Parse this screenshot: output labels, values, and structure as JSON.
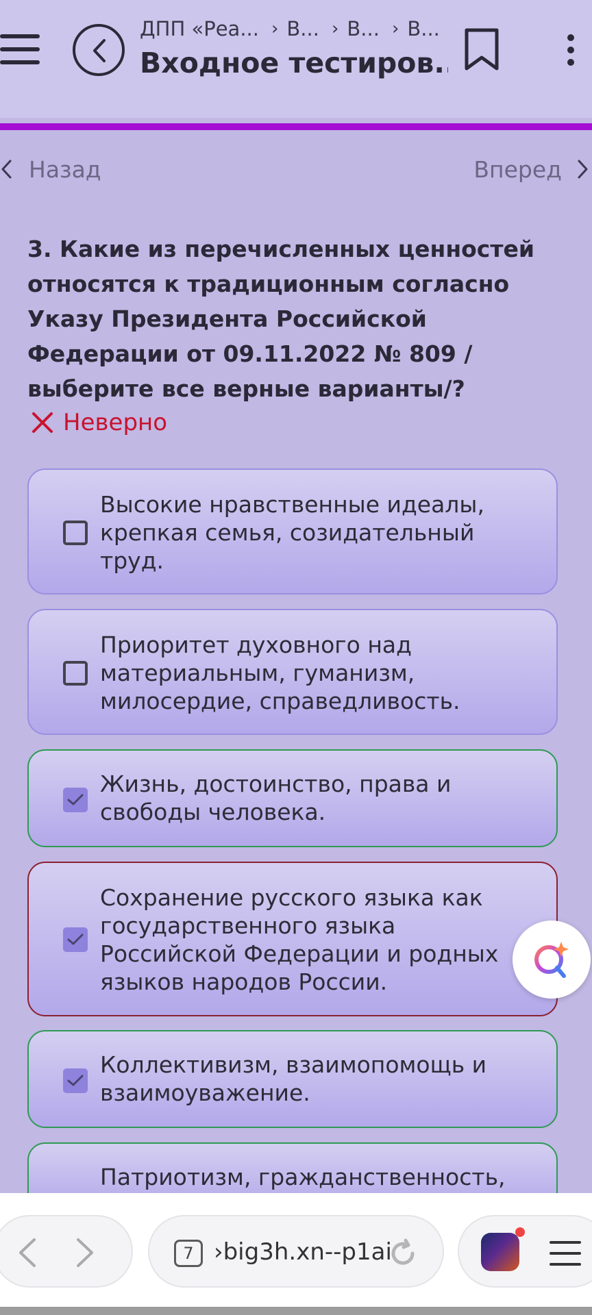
{
  "header": {
    "breadcrumbs": [
      "ДПП «Реа...",
      "В...",
      "В...",
      "В..."
    ],
    "title": "Входное тестиров..."
  },
  "nav": {
    "prev_label": "Назад",
    "next_label": "Вперед"
  },
  "question": {
    "text": "3.  Какие из перечисленных ценностей относятся к традиционным согласно Указу Президента Российской Федерации от 09.11.2022 № 809 /выберите все верные варианты/?",
    "verdict": "Неверно"
  },
  "options": [
    {
      "text": "Высокие нравственные идеалы, крепкая семья, созидательный труд.",
      "checked": false,
      "status": "neutral"
    },
    {
      "text": "Приоритет духовного над материальным, гуманизм, милосердие, справедливость.",
      "checked": false,
      "status": "neutral"
    },
    {
      "text": "Жизнь, достоинство, права и свободы человека.",
      "checked": true,
      "status": "correct"
    },
    {
      "text": "Сохранение русского языка как государственного языка Российской Федерации и родных языков народов России.",
      "checked": true,
      "status": "wrong"
    },
    {
      "text": "Коллективизм, взаимопомощь и взаимоуважение.",
      "checked": true,
      "status": "correct"
    },
    {
      "text": "Патриотизм, гражданственность,",
      "checked": true,
      "status": "correct"
    }
  ],
  "browser": {
    "tab_count": "7",
    "url": "›big3h.xn--p1ai"
  },
  "colors": {
    "background": "#c1b8e4",
    "header": "#cdc6ec",
    "progress": "#a40fd3",
    "error": "#c8132f",
    "correct_border": "#2e9a53",
    "wrong_border": "#8a2030",
    "checkbox_checked": "#8e82dd"
  },
  "icons": [
    "menu-icon",
    "back-arrow-icon",
    "bookmark-icon",
    "more-vertical-icon",
    "chevron-left-icon",
    "chevron-right-icon",
    "close-x-icon",
    "checkmark-icon",
    "ai-assistant-icon",
    "reload-icon",
    "hamburger-icon"
  ]
}
